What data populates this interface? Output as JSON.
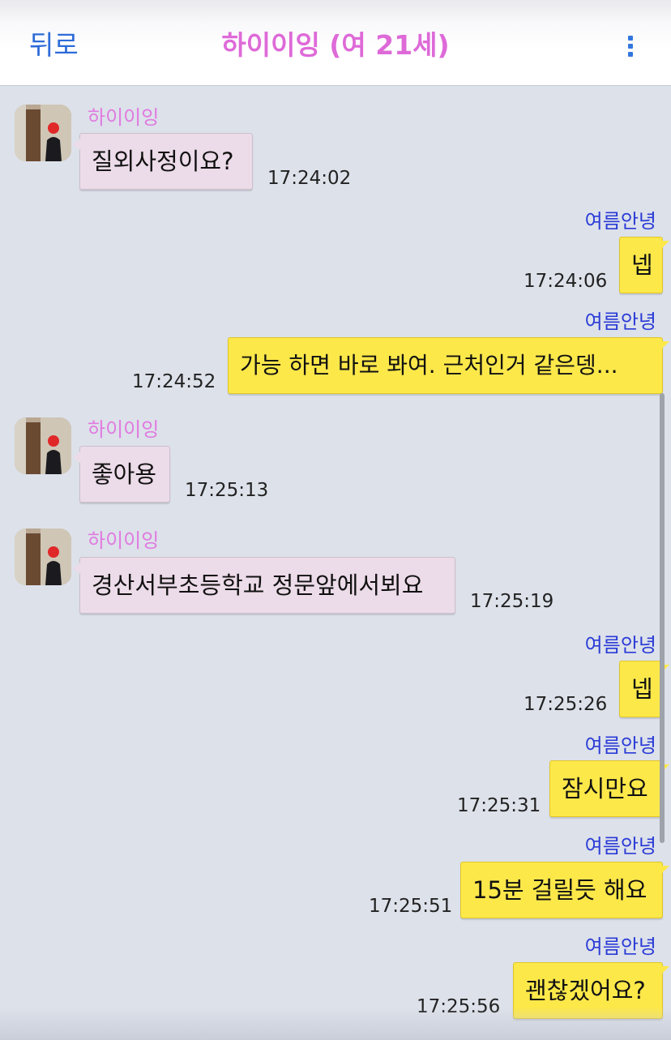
{
  "header": {
    "back_label": "뒤로",
    "title": "하이이잉 (여 21세)",
    "menu_icon": "vertical-dots-icon"
  },
  "colors": {
    "incoming_bubble": "#ecdbe8",
    "outgoing_bubble": "#fde84a",
    "incoming_name": "#e07ae0",
    "outgoing_name": "#2a3bd6",
    "title": "#de6ad8",
    "back": "#2d6bd8"
  },
  "messages": [
    {
      "sender": "하이이잉",
      "direction": "in",
      "text": "질외사정이요?",
      "time": "17:24:02"
    },
    {
      "sender": "여름안녕",
      "direction": "out",
      "text": "넵",
      "time": "17:24:06"
    },
    {
      "sender": "여름안녕",
      "direction": "out",
      "text": "가능 하면 바로 봐여. 근처인거 같은뎅...",
      "time": "17:24:52"
    },
    {
      "sender": "하이이잉",
      "direction": "in",
      "text": "좋아용",
      "time": "17:25:13"
    },
    {
      "sender": "하이이잉",
      "direction": "in",
      "text": "경산서부초등학교 정문앞에서뵈요",
      "time": "17:25:19"
    },
    {
      "sender": "여름안녕",
      "direction": "out",
      "text": "넵",
      "time": "17:25:26"
    },
    {
      "sender": "여름안녕",
      "direction": "out",
      "text": "잠시만요",
      "time": "17:25:31"
    },
    {
      "sender": "여름안녕",
      "direction": "out",
      "text": "15분 걸릴듯 해요",
      "time": "17:25:51"
    },
    {
      "sender": "여름안녕",
      "direction": "out",
      "text": "괜찮겠어요?",
      "time": "17:25:56"
    }
  ]
}
